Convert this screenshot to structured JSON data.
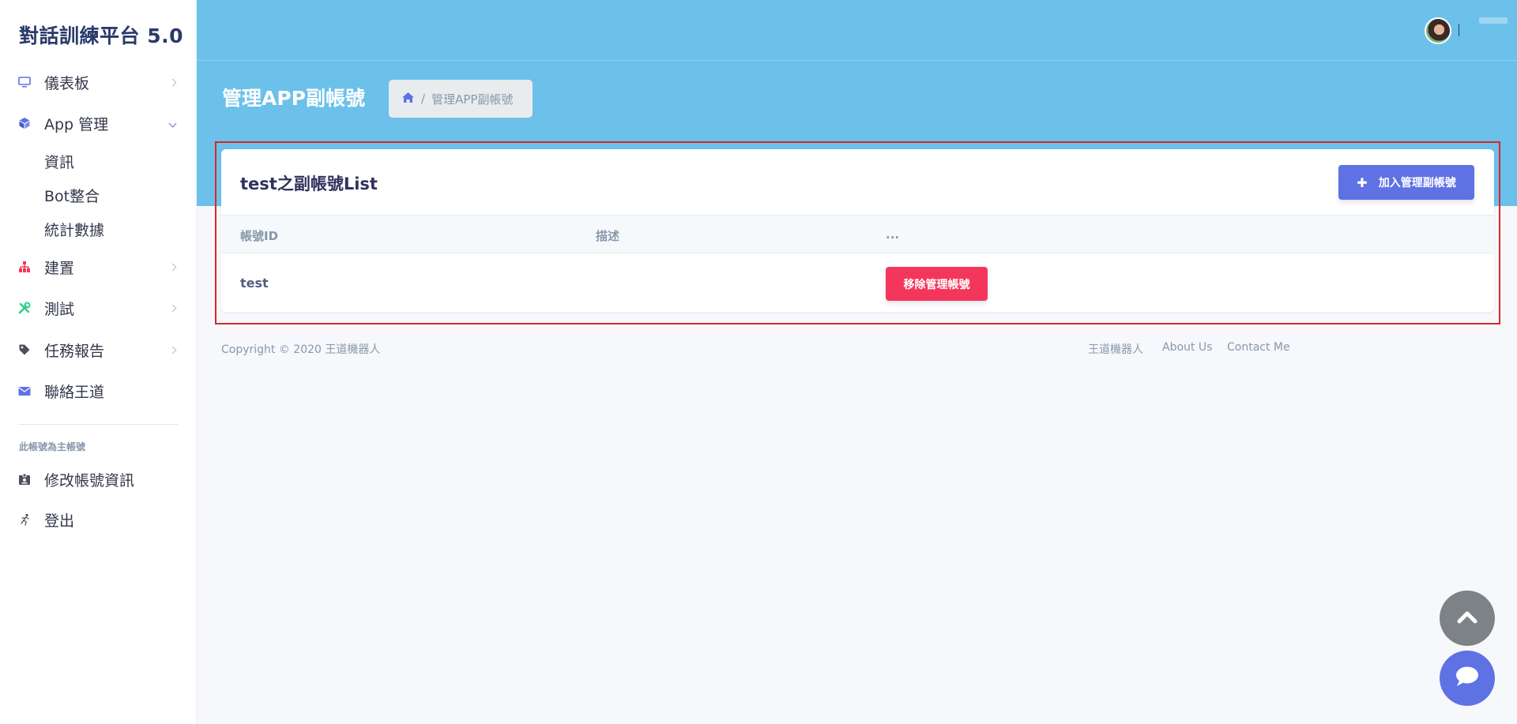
{
  "brand": "對話訓練平台 5.0",
  "sidebar": {
    "items": [
      {
        "label": "儀表板",
        "icon": "monitor-icon"
      },
      {
        "label": "App 管理",
        "icon": "cube-icon"
      },
      {
        "label": "建置",
        "icon": "hierarchy-icon"
      },
      {
        "label": "測試",
        "icon": "tools-icon"
      },
      {
        "label": "任務報告",
        "icon": "tag-icon"
      },
      {
        "label": "聯絡王道",
        "icon": "envelope-icon"
      }
    ],
    "subitems": [
      "資訊",
      "Bot整合",
      "統計數據"
    ],
    "section_heading": "此帳號為主帳號",
    "account_items": [
      {
        "label": "修改帳號資訊",
        "icon": "badge-icon"
      },
      {
        "label": "登出",
        "icon": "running-icon"
      }
    ]
  },
  "header": {
    "page_title": "管理APP副帳號",
    "breadcrumb": "管理APP副帳號"
  },
  "card": {
    "title": "test之副帳號List",
    "add_button": "加入管理副帳號",
    "columns": [
      "帳號ID",
      "描述",
      "..."
    ],
    "rows": [
      {
        "id": "test",
        "description": "",
        "action": "移除管理帳號"
      }
    ]
  },
  "footer": {
    "copyright": "Copyright © 2020 王道機器人",
    "links": [
      "王道機器人",
      "About Us",
      "Contact Me"
    ]
  },
  "colors": {
    "header": "#6cc1ea",
    "primary": "#5e72e4",
    "danger": "#f5365c",
    "highlight_border": "#d8262c"
  }
}
